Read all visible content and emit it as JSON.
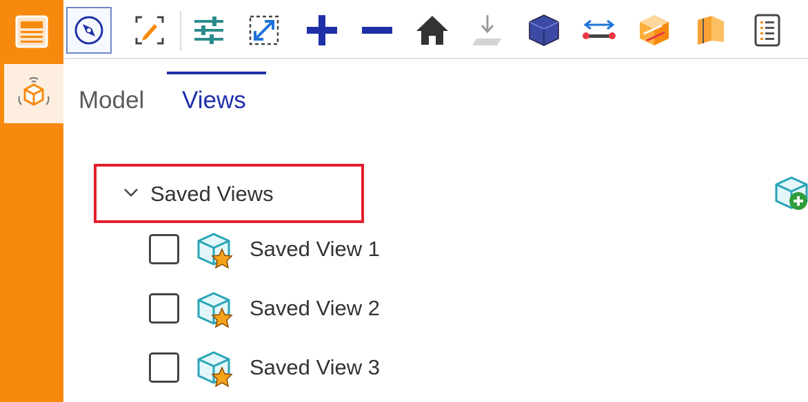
{
  "toolbar": {
    "buttons": [
      {
        "icon": "compass-icon",
        "active": true
      },
      {
        "icon": "markup-icon"
      },
      {
        "icon": "sliders-icon"
      },
      {
        "icon": "fit-view-icon"
      },
      {
        "icon": "zoom-in-icon"
      },
      {
        "icon": "zoom-out-icon"
      },
      {
        "icon": "home-icon"
      },
      {
        "icon": "drop-to-floor-icon"
      },
      {
        "icon": "solid-cube-icon"
      },
      {
        "icon": "measure-icon"
      },
      {
        "icon": "section-box-icon"
      },
      {
        "icon": "section-plane-icon"
      },
      {
        "icon": "properties-list-icon"
      }
    ]
  },
  "tabs": {
    "model": "Model",
    "views": "Views"
  },
  "saved_views": {
    "header": "Saved Views",
    "items": [
      {
        "label": "Saved View 1",
        "checked": false
      },
      {
        "label": "Saved View 2",
        "checked": false
      },
      {
        "label": "Saved View 3",
        "checked": false
      }
    ]
  },
  "colors": {
    "rail": "#f78a0e",
    "tab_active": "#1f2fa8",
    "highlight_box": "#e61e2b"
  }
}
